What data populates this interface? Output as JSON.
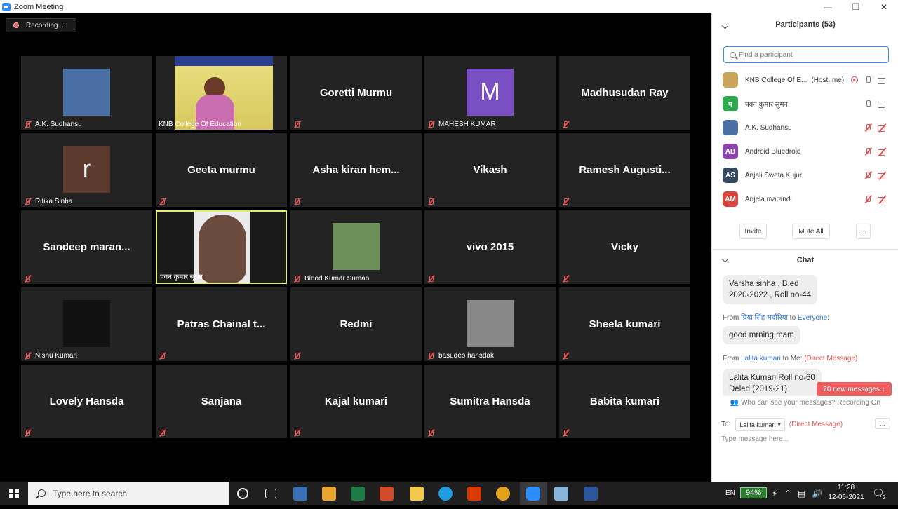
{
  "window": {
    "title": "Zoom Meeting"
  },
  "recording": {
    "label": "Recording..."
  },
  "tiles": [
    {
      "label": "A.K. Sudhansu",
      "type": "photo",
      "thumb": "#4a6fa5"
    },
    {
      "label": "KNB College Of Education",
      "type": "video"
    },
    {
      "label": "Goretti Murmu",
      "type": "name"
    },
    {
      "label": "MAHESH KUMAR",
      "type": "letter",
      "letter": "M",
      "color": "#7b4fc4"
    },
    {
      "label": "Madhusudan Ray",
      "type": "name"
    },
    {
      "label": "Ritika Sinha",
      "type": "letter",
      "letter": "r",
      "color": "#5d3a2e"
    },
    {
      "label": "Geeta murmu",
      "type": "name"
    },
    {
      "label": "Asha kiran hem...",
      "type": "name"
    },
    {
      "label": "Vikash",
      "type": "name"
    },
    {
      "label": "Ramesh Augusti...",
      "type": "name"
    },
    {
      "label": "Sandeep maran...",
      "type": "name"
    },
    {
      "label": "पवन कुमार सुमन",
      "type": "speaker"
    },
    {
      "label": "Binod Kumar Suman",
      "type": "photo",
      "thumb": "#6c8f5a"
    },
    {
      "label": "vivo 2015",
      "type": "name"
    },
    {
      "label": "Vicky",
      "type": "name"
    },
    {
      "label": "Nishu Kumari",
      "type": "photo",
      "thumb": "#111111"
    },
    {
      "label": "Patras Chainal t...",
      "type": "name"
    },
    {
      "label": "Redmi",
      "type": "name"
    },
    {
      "label": "basudeo hansdak",
      "type": "photo",
      "thumb": "#888888"
    },
    {
      "label": "Sheela kumari",
      "type": "name"
    },
    {
      "label": "Lovely Hansda",
      "type": "name"
    },
    {
      "label": "Sanjana",
      "type": "name"
    },
    {
      "label": "Kajal kumari",
      "type": "name"
    },
    {
      "label": "Sumitra Hansda",
      "type": "name"
    },
    {
      "label": "Babita kumari",
      "type": "name"
    }
  ],
  "participants": {
    "header": "Participants (53)",
    "search_placeholder": "Find a participant",
    "list": [
      {
        "initials": "",
        "name": "KNB College Of E...",
        "role": "(Host, me)",
        "color": "#c9a55c",
        "mic": "on",
        "cam": "on",
        "rec": true
      },
      {
        "initials": "प",
        "name": "पवन कुमार सुमन",
        "role": "",
        "color": "#2fa84f",
        "mic": "on",
        "cam": "on",
        "rec": false
      },
      {
        "initials": "",
        "name": "A.K. Sudhansu",
        "role": "",
        "color": "#4a6fa5",
        "mic": "off",
        "cam": "off",
        "rec": false
      },
      {
        "initials": "AB",
        "name": "Android Bluedroid",
        "role": "",
        "color": "#8e44ad",
        "mic": "off",
        "cam": "off",
        "rec": false
      },
      {
        "initials": "AS",
        "name": "Anjali Sweta Kujur",
        "role": "",
        "color": "#34495e",
        "mic": "off",
        "cam": "off",
        "rec": false
      },
      {
        "initials": "AM",
        "name": "Anjela marandi",
        "role": "",
        "color": "#d9453d",
        "mic": "off",
        "cam": "off",
        "rec": false
      }
    ],
    "invite_label": "Invite",
    "mute_all_label": "Mute All",
    "more_label": "..."
  },
  "chat": {
    "header": "Chat",
    "msg1_line1": "Varsha sinha  , B.ed",
    "msg1_line2": "2020-2022 , Roll no-44",
    "from2_prefix": "From",
    "from2_name": "प्रिया सिंह भदौरिया",
    "from2_to": "to",
    "from2_target": "Everyone",
    "msg2": "good mrning mam",
    "from3_prefix": "From",
    "from3_name": "Lalita kumari",
    "from3_to": "to Me:",
    "from3_dm": "(Direct Message)",
    "msg3_line1": "Lalita Kumari  Roll no-60",
    "msg3_line2": "Deled (2019-21)",
    "new_messages": "20 new messages ↓",
    "who_can_see": "Who can see your messages? Recording On",
    "to_label": "To:",
    "to_value": "Lalita kumari",
    "to_dm": "(Direct Message)",
    "more": "...",
    "input_placeholder": "Type message here..."
  },
  "taskbar": {
    "search_placeholder": "Type here to search",
    "lang": "EN",
    "battery": "94%",
    "time": "11:28",
    "date": "12-06-2021",
    "notif_count": "2"
  }
}
